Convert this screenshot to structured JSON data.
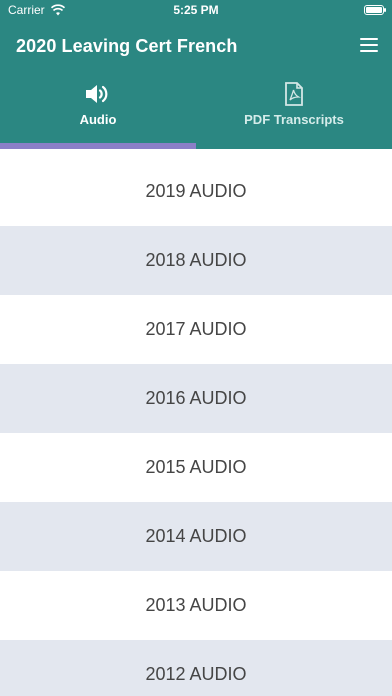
{
  "statusbar": {
    "carrier": "Carrier",
    "time": "5:25 PM"
  },
  "header": {
    "title": "2020 Leaving Cert French",
    "menu_icon": "hamburger-menu-icon"
  },
  "tabs": [
    {
      "label": "Audio",
      "icon": "speaker-icon",
      "selected": true
    },
    {
      "label": "PDF Transcripts",
      "icon": "pdf-file-icon",
      "selected": false
    }
  ],
  "colors": {
    "header": "#2b8782",
    "indicator": "#8b7fc7",
    "row_alt": "#e3e7ef"
  },
  "list": {
    "items": [
      {
        "label": "2019 AUDIO"
      },
      {
        "label": "2018 AUDIO"
      },
      {
        "label": "2017 AUDIO"
      },
      {
        "label": "2016 AUDIO"
      },
      {
        "label": "2015 AUDIO"
      },
      {
        "label": "2014 AUDIO"
      },
      {
        "label": "2013 AUDIO"
      },
      {
        "label": "2012 AUDIO"
      }
    ]
  }
}
